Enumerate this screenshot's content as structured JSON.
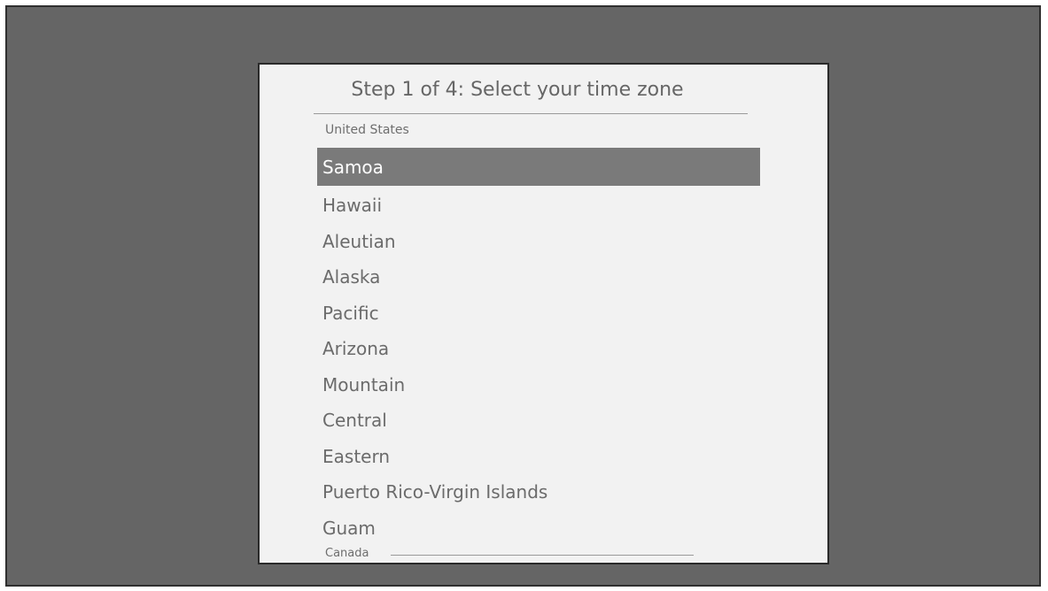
{
  "screen": {
    "title": "Step 1 of 4: Select your time zone",
    "sections": {
      "united_states": "United States",
      "canada": "Canada"
    },
    "selected_index": 0,
    "zones": [
      "Samoa",
      "Hawaii",
      "Aleutian",
      "Alaska",
      "Pacific",
      "Arizona",
      "Mountain",
      "Central",
      "Eastern",
      "Puerto Rico-Virgin Islands",
      "Guam"
    ]
  },
  "colors": {
    "backdrop": "#656565",
    "panel": "#f2f2f2",
    "highlight": "#7a7a7a",
    "text": "#6b6b6b"
  }
}
